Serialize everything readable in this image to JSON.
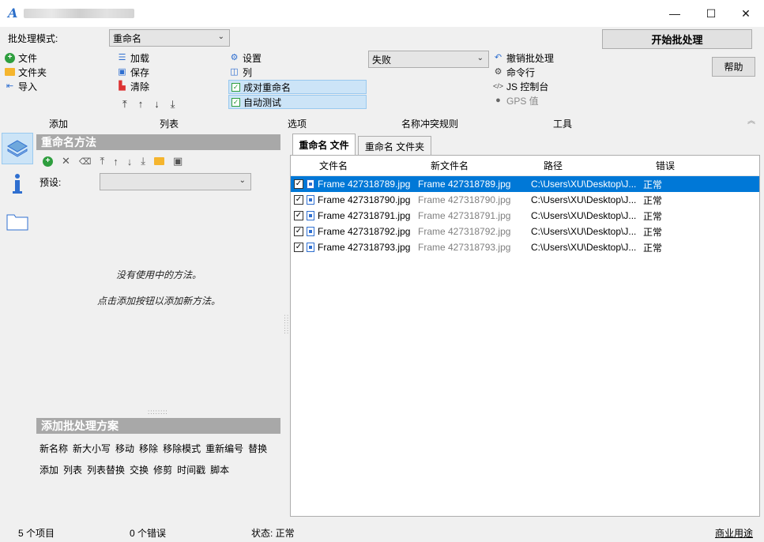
{
  "window": {
    "app_icon_glyph": "A",
    "minimize_glyph": "—",
    "maximize_glyph": "☐",
    "close_glyph": "✕"
  },
  "batch": {
    "mode_label": "批处理模式:",
    "mode_value": "重命名",
    "start_label": "开始批处理",
    "help_label": "帮助"
  },
  "add_group": {
    "title": "添加",
    "items": [
      {
        "label": "文件",
        "icon": "plus-circle-icon"
      },
      {
        "label": "文件夹",
        "icon": "folder-icon"
      },
      {
        "label": "导入",
        "icon": "import-arrow-icon"
      }
    ]
  },
  "list_group": {
    "title": "列表",
    "items": [
      {
        "label": "加载",
        "icon": "list-icon"
      },
      {
        "label": "保存",
        "icon": "save-icon"
      },
      {
        "label": "清除",
        "icon": "clear-icon"
      }
    ],
    "arrows": [
      "⤒",
      "↑",
      "↓",
      "⤓"
    ]
  },
  "options_group": {
    "title": "选项",
    "items": [
      {
        "label": "设置",
        "icon": "settings-icon"
      },
      {
        "label": "列",
        "icon": "columns-icon"
      }
    ],
    "checks": [
      {
        "label": "成对重命名",
        "checked": true
      },
      {
        "label": "自动测试",
        "checked": true
      }
    ]
  },
  "conflict_group": {
    "title": "名称冲突规则",
    "value": "失败"
  },
  "tools_group": {
    "title": "工具",
    "items": [
      {
        "label": "撤销批处理",
        "icon": "undo-icon"
      },
      {
        "label": "命令行",
        "icon": "gear-icon"
      },
      {
        "label": "JS 控制台",
        "icon": "code-icon"
      },
      {
        "label": "GPS 值",
        "icon": "location-pin-icon"
      }
    ]
  },
  "methods_panel": {
    "title": "重命名方法",
    "preset_label": "预设:",
    "preset_value": "",
    "empty_line1": "没有使用中的方法。",
    "empty_line2": "点击添加按钮以添加新方法。"
  },
  "add_scheme": {
    "title": "添加批处理方案",
    "row1": [
      "新名称",
      "新大小写",
      "移动",
      "移除",
      "移除模式",
      "重新编号",
      "替换"
    ],
    "row2": [
      "添加",
      "列表",
      "列表替换",
      "交换",
      "修剪",
      "时间戳",
      "脚本"
    ]
  },
  "tabs": [
    "重命名 文件",
    "重命名 文件夹"
  ],
  "columns": [
    "文件名",
    "新文件名",
    "路径",
    "错误"
  ],
  "files": [
    {
      "name": "Frame 427318789.jpg",
      "new_name": "Frame 427318789.jpg",
      "path": "C:\\Users\\XU\\Desktop\\J...",
      "error": "正常",
      "checked": true,
      "selected": true
    },
    {
      "name": "Frame 427318790.jpg",
      "new_name": "Frame 427318790.jpg",
      "path": "C:\\Users\\XU\\Desktop\\J...",
      "error": "正常",
      "checked": true,
      "selected": false
    },
    {
      "name": "Frame 427318791.jpg",
      "new_name": "Frame 427318791.jpg",
      "path": "C:\\Users\\XU\\Desktop\\J...",
      "error": "正常",
      "checked": true,
      "selected": false
    },
    {
      "name": "Frame 427318792.jpg",
      "new_name": "Frame 427318792.jpg",
      "path": "C:\\Users\\XU\\Desktop\\J...",
      "error": "正常",
      "checked": true,
      "selected": false
    },
    {
      "name": "Frame 427318793.jpg",
      "new_name": "Frame 427318793.jpg",
      "path": "C:\\Users\\XU\\Desktop\\J...",
      "error": "正常",
      "checked": true,
      "selected": false
    }
  ],
  "status": {
    "items": "5 个项目",
    "errors": "0 个错误",
    "state": "状态: 正常",
    "license": "商业用途"
  },
  "colors": {
    "selection": "#0078d7",
    "section_header": "#a8a8a8",
    "check_highlight": "#cce4f7"
  }
}
